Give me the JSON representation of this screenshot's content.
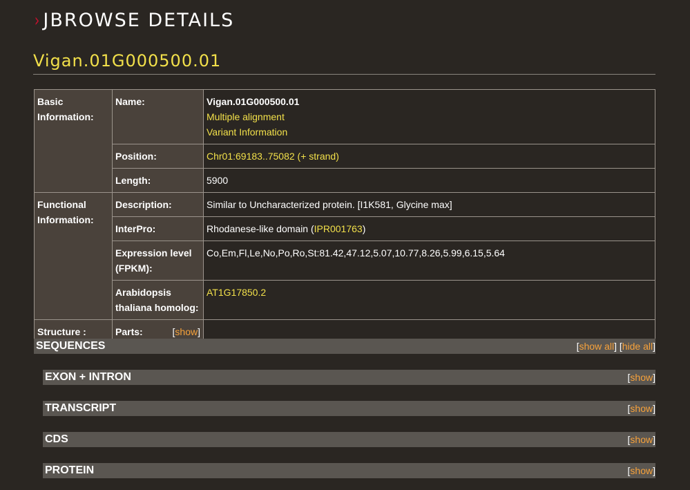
{
  "header": {
    "chevron": "›",
    "title": "JBROWSE DETAILS"
  },
  "feature": {
    "name": "Vigan.01G000500.01"
  },
  "table": {
    "basic_group": "Basic Information:",
    "name_label": "Name:",
    "name_value": "Vigan.01G000500.01",
    "multiple_alignment_link": "Multiple alignment",
    "variant_info_link": "Variant Information",
    "position_label": "Position:",
    "position_value": "Chr01:69183..75082 (+ strand)",
    "length_label": "Length:",
    "length_value": "5900",
    "functional_group": "Functional Information:",
    "description_label": "Description:",
    "description_value": "Similar to Uncharacterized protein. [I1K581, Glycine max]",
    "interpro_label": "InterPro:",
    "interpro_text": "Rhodanese-like domain (",
    "interpro_link": "IPR001763",
    "interpro_close": ")",
    "expression_label": "Expression level (FPKM):",
    "expression_value": "Co,Em,Fl,Le,No,Po,Ro,St:81.42,47.12,5.07,10.77,8.26,5.99,6.15,5.64",
    "homolog_label": "Arabidopsis thaliana homolog:",
    "homolog_link": "AT1G17850.2",
    "structure_group": "Structure :",
    "parts_label": "Parts:",
    "parts_show": "show"
  },
  "sections": {
    "sequences": {
      "label": "SEQUENCES",
      "show_all": "show all",
      "hide_all": "hide all"
    },
    "exon_intron": {
      "label": "EXON + INTRON",
      "show": "show"
    },
    "transcript": {
      "label": "TRANSCRIPT",
      "show": "show"
    },
    "cds": {
      "label": "CDS",
      "show": "show"
    },
    "protein": {
      "label": "PROTEIN",
      "show": "show"
    }
  },
  "colors": {
    "background": "#2a2622",
    "label_cell": "#4a423b",
    "section_bar": "#5a5651",
    "link_yellow": "#f2e04a",
    "link_orange": "#f7a23b",
    "chevron_red": "#c8102e"
  }
}
